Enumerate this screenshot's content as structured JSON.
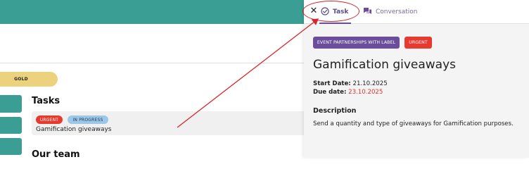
{
  "background": {
    "badge": "GOLD",
    "tasks_heading": "Tasks",
    "task_card": {
      "tags": [
        "URGENT",
        "IN PROGRESS"
      ],
      "title": "Gamification giveaways"
    },
    "team_heading": "Our team"
  },
  "drawer": {
    "close_glyph": "✕",
    "tabs": [
      {
        "label": "Task",
        "icon": "check-circle-icon",
        "active": true
      },
      {
        "label": "Conversation",
        "icon": "chat-bubbles-icon",
        "active": false
      }
    ],
    "labels": [
      "EVENT PARTNERSHIPS WITH LABEL",
      "URGENT"
    ],
    "title": "Gamification giveaways",
    "start_date_label": "Start Date:",
    "start_date": "21.10.2025",
    "due_date_label": "Due date:",
    "due_date": "23.10.2025",
    "description_heading": "Description",
    "description": "Send a quantity and type of giveaways for Gamification purposes."
  },
  "colors": {
    "teal": "#3a9e94",
    "purple": "#6b4e9b",
    "urgent_red": "#e8392f",
    "gold": "#ecd27c",
    "annotation_red": "#d9262a"
  }
}
